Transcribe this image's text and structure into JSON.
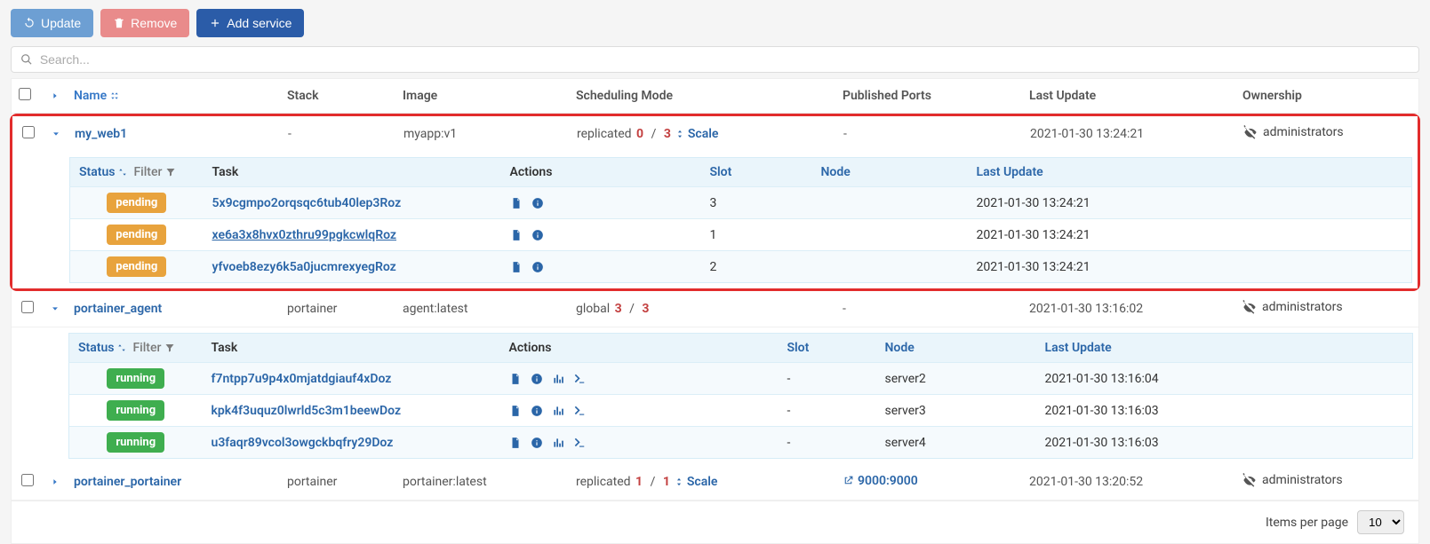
{
  "toolbar": {
    "update": "Update",
    "remove": "Remove",
    "add_service": "Add service"
  },
  "search": {
    "placeholder": "Search..."
  },
  "columns": {
    "name": "Name",
    "stack": "Stack",
    "image": "Image",
    "sched": "Scheduling Mode",
    "ports": "Published Ports",
    "update": "Last Update",
    "own": "Ownership"
  },
  "sub_columns": {
    "status": "Status",
    "filter": "Filter",
    "task": "Task",
    "actions": "Actions",
    "slot": "Slot",
    "node": "Node",
    "last": "Last Update"
  },
  "services": [
    {
      "name": "my_web1",
      "stack": "-",
      "image": "myapp:v1",
      "sched_mode": "replicated",
      "repl_current": "0",
      "repl_total": "3",
      "scale": "Scale",
      "ports": "-",
      "last_update": "2021-01-30 13:24:21",
      "owner": "administrators",
      "tasks": [
        {
          "status": "pending",
          "id": "5x9cgmpo2orqsqc6tub40lep3Roz",
          "slot": "3",
          "node": "",
          "last": "2021-01-30 13:24:21",
          "mini": true
        },
        {
          "status": "pending",
          "id": "xe6a3x8hvx0zthru99pgkcwlqRoz",
          "slot": "1",
          "node": "",
          "last": "2021-01-30 13:24:21",
          "mini": true,
          "under": true
        },
        {
          "status": "pending",
          "id": "yfvoeb8ezy6k5a0jucmrexyegRoz",
          "slot": "2",
          "node": "",
          "last": "2021-01-30 13:24:21",
          "mini": true
        }
      ]
    },
    {
      "name": "portainer_agent",
      "stack": "portainer",
      "image": "agent:latest",
      "sched_mode": "global",
      "repl_current": "3",
      "repl_total": "3",
      "scale": "",
      "ports": "-",
      "last_update": "2021-01-30 13:16:02",
      "owner": "administrators",
      "tasks": [
        {
          "status": "running",
          "id": "f7ntpp7u9p4x0mjatdgiauf4xDoz",
          "slot": "-",
          "node": "server2",
          "last": "2021-01-30 13:16:04"
        },
        {
          "status": "running",
          "id": "kpk4f3uquz0lwrld5c3m1beewDoz",
          "slot": "-",
          "node": "server3",
          "last": "2021-01-30 13:16:03"
        },
        {
          "status": "running",
          "id": "u3faqr89vcol3owgckbqfry29Doz",
          "slot": "-",
          "node": "server4",
          "last": "2021-01-30 13:16:03"
        }
      ]
    },
    {
      "name": "portainer_portainer",
      "stack": "portainer",
      "image": "portainer:latest",
      "sched_mode": "replicated",
      "repl_current": "1",
      "repl_total": "1",
      "scale": "Scale",
      "ports_link": "9000:9000",
      "last_update": "2021-01-30 13:20:52",
      "owner": "administrators"
    }
  ],
  "footer": {
    "label": "Items per page",
    "value": "10"
  }
}
